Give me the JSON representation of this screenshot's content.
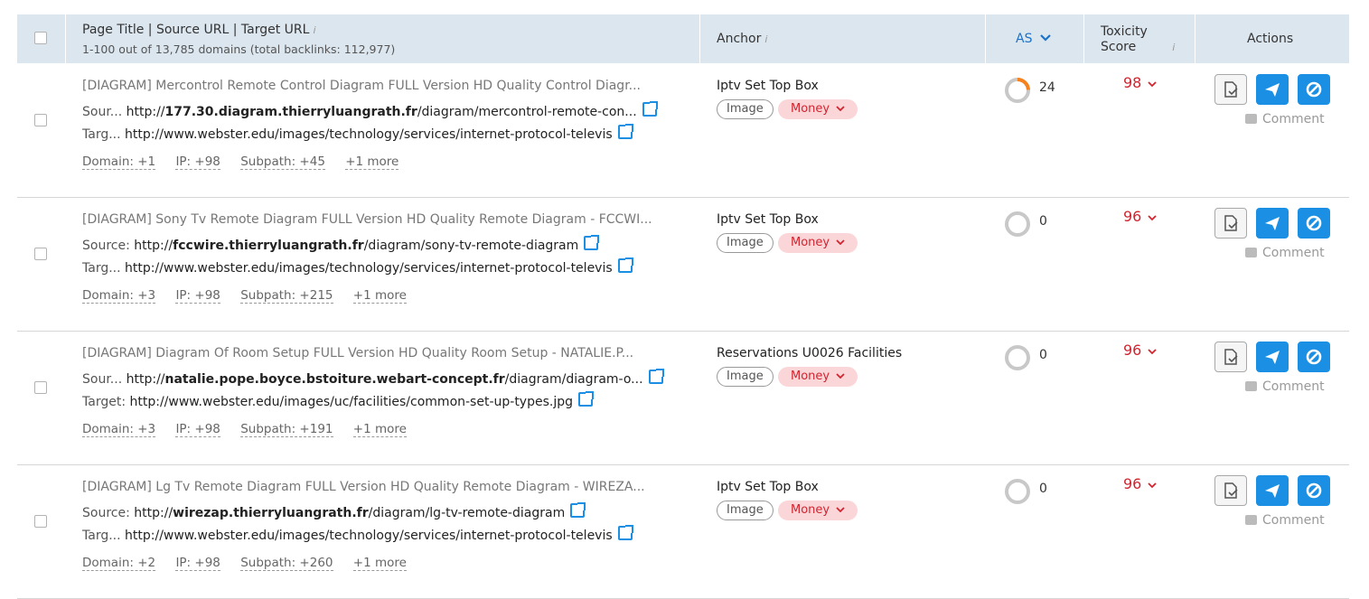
{
  "header": {
    "page_title": "Page Title | Source URL | Target URL",
    "summary": "1-100 out of 13,785 domains (total backlinks: 112,977)",
    "anchor": "Anchor",
    "as": "AS",
    "toxicity": [
      "Toxicity",
      "Score"
    ],
    "actions": "Actions",
    "info_glyph": "i"
  },
  "rows": [
    {
      "title": "[DIAGRAM] Mercontrol Remote Control Diagram FULL Version HD Quality Control Diagr...",
      "source_label": "Sour...",
      "source_pre": "http://",
      "source_domain": "177.30.diagram.thierryluangrath.fr",
      "source_path": "/diagram/mercontrol-remote-con...",
      "target_label": "Targ...",
      "target_url": "http://www.webster.edu/images/technology/services/internet-protocol-televis",
      "domain": "Domain: +1",
      "ip": "IP: +98",
      "subpath": "Subpath: +45",
      "more": "+1 more",
      "anchor": "Iptv Set Top Box",
      "tag_image": "Image",
      "tag_money": "Money",
      "as_value": "24",
      "as_fraction": 0.24,
      "toxicity": "98"
    },
    {
      "title": "[DIAGRAM] Sony Tv Remote Diagram FULL Version HD Quality Remote Diagram - FCCWI...",
      "source_label": "Source:",
      "source_pre": "http://",
      "source_domain": "fccwire.thierryluangrath.fr",
      "source_path": "/diagram/sony-tv-remote-diagram",
      "target_label": "Targ...",
      "target_url": "http://www.webster.edu/images/technology/services/internet-protocol-televis",
      "domain": "Domain: +3",
      "ip": "IP: +98",
      "subpath": "Subpath: +215",
      "more": "+1 more",
      "anchor": "Iptv Set Top Box",
      "tag_image": "Image",
      "tag_money": "Money",
      "as_value": "0",
      "as_fraction": 0,
      "toxicity": "96"
    },
    {
      "title": "[DIAGRAM] Diagram Of Room Setup FULL Version HD Quality Room Setup - NATALIE.P...",
      "source_label": "Sour...",
      "source_pre": "http://",
      "source_domain": "natalie.pope.boyce.bstoiture.webart-concept.fr",
      "source_path": "/diagram/diagram-o...",
      "target_label": "Target:",
      "target_url": "http://www.webster.edu/images/uc/facilities/common-set-up-types.jpg",
      "domain": "Domain: +3",
      "ip": "IP: +98",
      "subpath": "Subpath: +191",
      "more": "+1 more",
      "anchor": "Reservations U0026 Facilities",
      "tag_image": "Image",
      "tag_money": "Money",
      "as_value": "0",
      "as_fraction": 0,
      "toxicity": "96"
    },
    {
      "title": "[DIAGRAM] Lg Tv Remote Diagram FULL Version HD Quality Remote Diagram - WIREZA...",
      "source_label": "Source:",
      "source_pre": "http://",
      "source_domain": "wirezap.thierryluangrath.fr",
      "source_path": "/diagram/lg-tv-remote-diagram",
      "target_label": "Targ...",
      "target_url": "http://www.webster.edu/images/technology/services/internet-protocol-televis",
      "domain": "Domain: +2",
      "ip": "IP: +98",
      "subpath": "Subpath: +260",
      "more": "+1 more",
      "anchor": "Iptv Set Top Box",
      "tag_image": "Image",
      "tag_money": "Money",
      "as_value": "0",
      "as_fraction": 0,
      "toxicity": "96"
    }
  ],
  "comment_label": "Comment",
  "colors": {
    "accent": "#1a8fe3",
    "toxic": "#d1242f",
    "header_bg": "#dce6ef",
    "donut_fill": "#f5821f",
    "donut_track": "#c8c8c8"
  },
  "icons": {
    "ext": "external-link-icon",
    "whitelist": "whitelist-icon",
    "send": "send-icon",
    "disavow": "disavow-icon",
    "comment": "comment-icon"
  }
}
